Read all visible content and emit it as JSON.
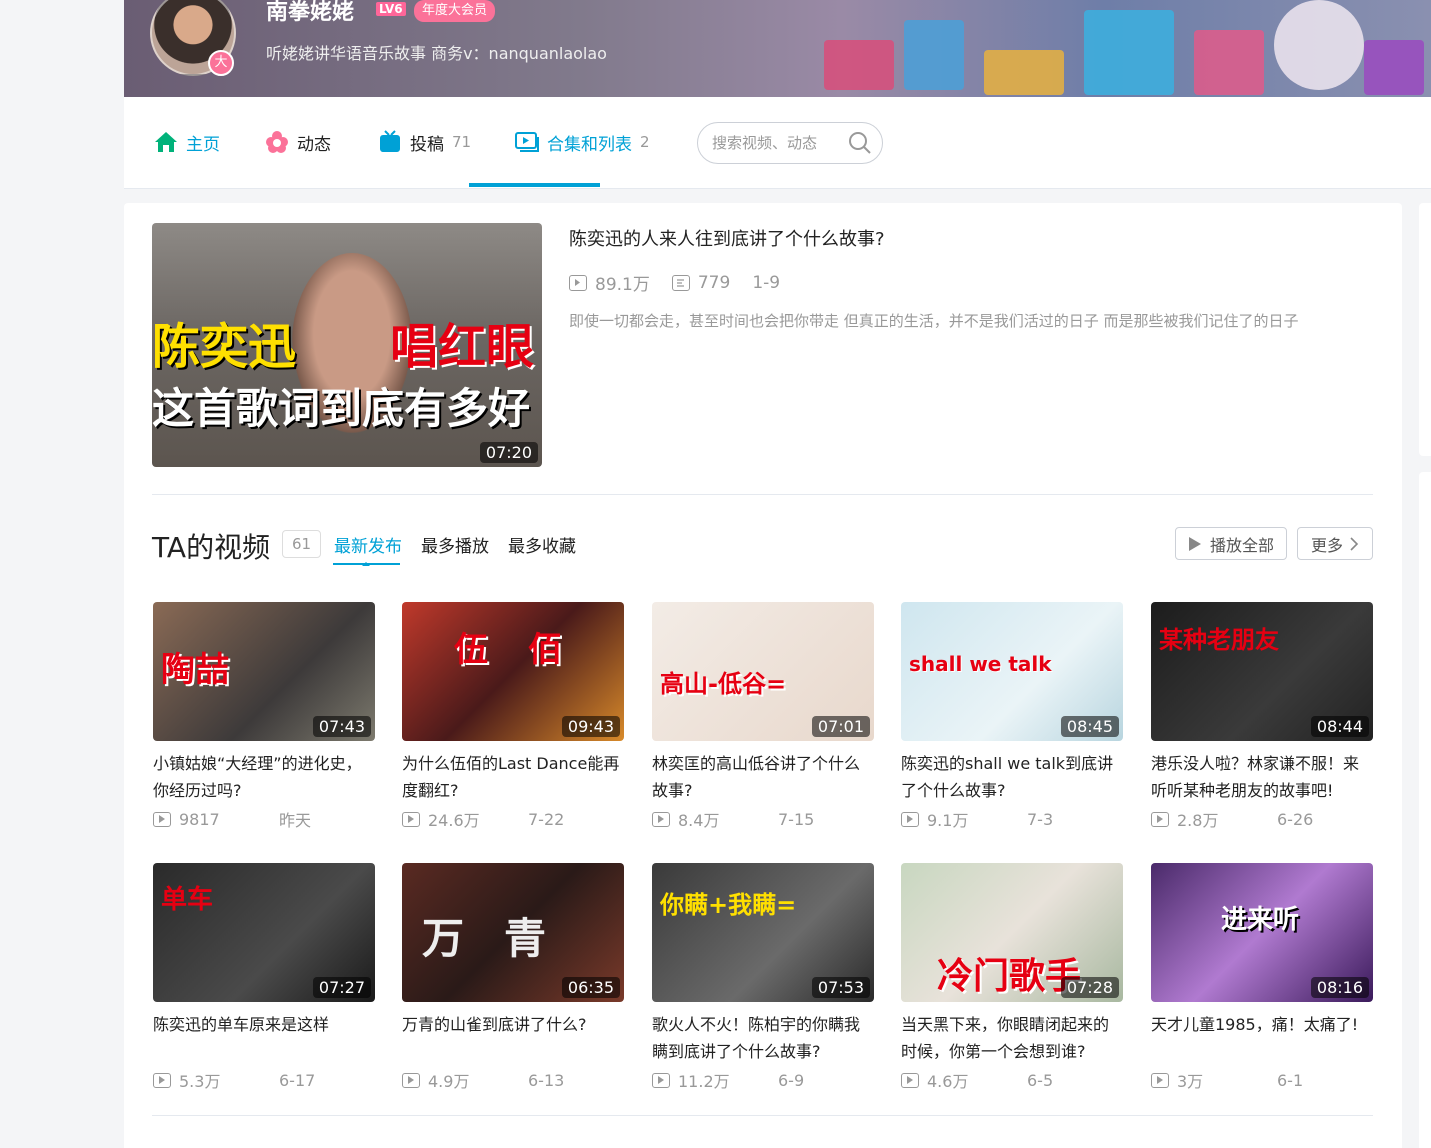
{
  "profile": {
    "name": "南拳姥姥",
    "level": "LV6",
    "vip_badge": "年度大会员",
    "avatar_badge": "大",
    "sign": "听姥姥讲华语音乐故事 商务v：nanquanlaolao"
  },
  "nav": {
    "items": [
      {
        "label": "主页",
        "count": "",
        "icon": "home-icon",
        "color": "#00b5e5"
      },
      {
        "label": "动态",
        "count": "",
        "icon": "flower-icon",
        "color": "#fb7299"
      },
      {
        "label": "投稿",
        "count": "71",
        "icon": "tv-icon",
        "color": "#00a1d6"
      },
      {
        "label": "合集和列表",
        "count": "2",
        "icon": "playlist-icon",
        "color": "#00a1d6"
      }
    ],
    "active": "合集和列表",
    "search_placeholder": "搜索视频、动态"
  },
  "featured": {
    "thumb_text1": "陈奕迅",
    "thumb_text2": "唱红眼",
    "thumb_text3": "这首歌词到底有多好",
    "duration": "07:20",
    "title": "陈奕迅的人来人往到底讲了个什么故事?",
    "plays": "89.1万",
    "danmaku": "779",
    "range": "1-9",
    "desc": "即使一切都会走，甚至时间也会把你带走 但真正的生活，并不是我们活过的日子 而是那些被我们记住了的日子"
  },
  "videos_section": {
    "title": "TA的视频",
    "count": "61",
    "tabs": [
      "最新发布",
      "最多播放",
      "最多收藏"
    ],
    "play_all": "播放全部",
    "more": "更多"
  },
  "videos": [
    {
      "thumb_text": "陶喆",
      "duration": "07:43",
      "title": "小镇姑娘“大经理”的进化史，你经历过吗?",
      "plays": "9817",
      "date": "昨天"
    },
    {
      "thumb_text": "伍佰",
      "duration": "09:43",
      "title": "为什么伍佰的Last Dance能再度翻红?",
      "plays": "24.6万",
      "date": "7-22"
    },
    {
      "thumb_text": "高山-低谷=",
      "duration": "07:01",
      "title": "林奕匡的高山低谷讲了个什么故事?",
      "plays": "8.4万",
      "date": "7-15"
    },
    {
      "thumb_text": "shall we talk",
      "duration": "08:45",
      "title": "陈奕迅的shall we talk到底讲了个什么故事?",
      "plays": "9.1万",
      "date": "7-3"
    },
    {
      "thumb_text": "某种老朋友",
      "duration": "08:44",
      "title": "港乐没人啦？林家谦不服！来听听某种老朋友的故事吧!",
      "plays": "2.8万",
      "date": "6-26"
    },
    {
      "thumb_text": "单车",
      "duration": "07:27",
      "title": "陈奕迅的单车原来是这样",
      "plays": "5.3万",
      "date": "6-17"
    },
    {
      "thumb_text": "万青",
      "duration": "06:35",
      "title": "万青的山雀到底讲了什么?",
      "plays": "4.9万",
      "date": "6-13"
    },
    {
      "thumb_text": "你瞒+我瞒=",
      "duration": "07:53",
      "title": "歌火人不火！陈柏宇的你瞒我瞒到底讲了个什么故事?",
      "plays": "11.2万",
      "date": "6-9"
    },
    {
      "thumb_text": "冷门歌手",
      "duration": "07:28",
      "title": "当天黑下来，你眼睛闭起来的时候，你第一个会想到谁?",
      "plays": "4.6万",
      "date": "6-5"
    },
    {
      "thumb_text": "进来听",
      "duration": "08:16",
      "title": "天才儿童1985，痛！太痛了!",
      "plays": "3万",
      "date": "6-1"
    }
  ]
}
